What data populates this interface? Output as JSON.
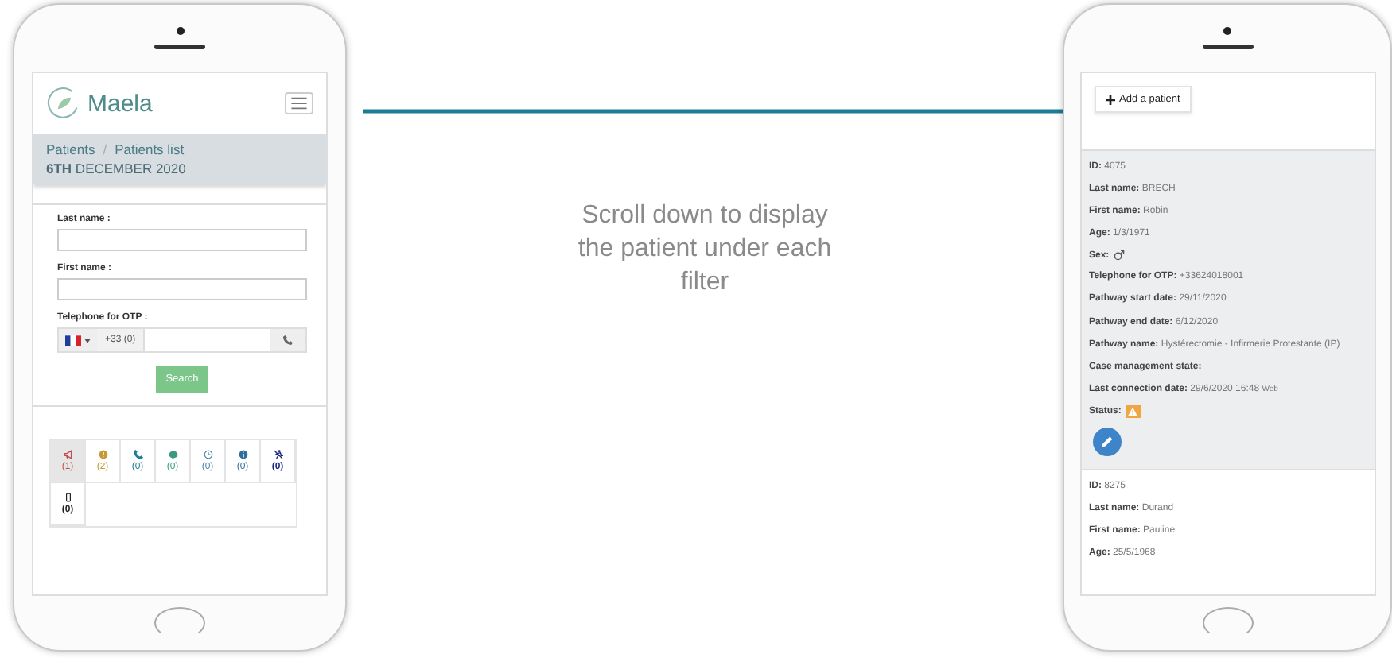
{
  "left_phone": {
    "logo": "Maela",
    "breadcrumb": {
      "items": [
        "Patients",
        "Patients list"
      ],
      "separator": "/"
    },
    "date": "**6TH** DECEMBER 2020",
    "form": {
      "fields": [
        {
          "label": "Last name :"
        },
        {
          "label": "First name :"
        }
      ],
      "phone": {
        "label": "Telephone for OTP :",
        "prefix": "+33 (0)"
      },
      "search_button": "Search"
    },
    "filters": [
      {
        "kind": "megaphone",
        "count": "(1)",
        "color": "#c0504d",
        "selected": true
      },
      {
        "kind": "alert",
        "count": "(2)",
        "color": "#c49a35",
        "selected": false
      },
      {
        "kind": "phone",
        "count": "(0)",
        "color": "#1f7f96",
        "selected": false
      },
      {
        "kind": "chat",
        "count": "(0)",
        "color": "#3a9a80",
        "selected": false
      },
      {
        "kind": "clock",
        "count": "(0)",
        "color": "#4a86a8",
        "selected": false
      },
      {
        "kind": "info",
        "count": "(0)",
        "color": "#2f6d9c",
        "selected": false
      },
      {
        "kind": "runner",
        "count": "(0)",
        "color": "#1c2a80",
        "selected": false
      },
      {
        "kind": "mobile",
        "count": "(0)",
        "color": "#222222",
        "selected": false
      }
    ]
  },
  "arrow_caption": "Scroll down to display the patient under each filter",
  "right_phone": {
    "add_button": "Add a patient",
    "patients": [
      {
        "selected": true,
        "fields": [
          {
            "kind": "text",
            "label": "ID:",
            "value": "4075"
          },
          {
            "kind": "text",
            "label": "Last name:",
            "value": "BRECH"
          },
          {
            "kind": "text",
            "label": "First name:",
            "value": "Robin"
          },
          {
            "kind": "text",
            "label": "Age:",
            "value": "1/3/1971"
          },
          {
            "kind": "sex",
            "label": "Sex:"
          },
          {
            "kind": "text",
            "label": "Telephone for OTP:",
            "value": "+33624018001"
          },
          {
            "kind": "text",
            "label": "Pathway start date:",
            "value": "29/11/2020"
          },
          {
            "kind": "text",
            "label": "Pathway end date:",
            "value": "6/12/2020"
          },
          {
            "kind": "text",
            "label": "Pathway name:",
            "value": "Hystérectomie - Infirmerie Protestante (IP)"
          },
          {
            "kind": "text",
            "label": "Case management state:"
          },
          {
            "kind": "text",
            "label": "Last connection date:",
            "value": "29/6/2020 16:48",
            "note": "Web"
          },
          {
            "kind": "status",
            "label": "Status:"
          },
          {
            "kind": "edit"
          }
        ]
      },
      {
        "selected": false,
        "fields": [
          {
            "kind": "text",
            "label": "ID:",
            "value": "8275"
          },
          {
            "kind": "text",
            "label": "Last name:",
            "value": "Durand"
          },
          {
            "kind": "text",
            "label": "First name:",
            "value": "Pauline"
          },
          {
            "kind": "text",
            "label": "Age:",
            "value": "25/5/1968"
          }
        ]
      }
    ]
  }
}
